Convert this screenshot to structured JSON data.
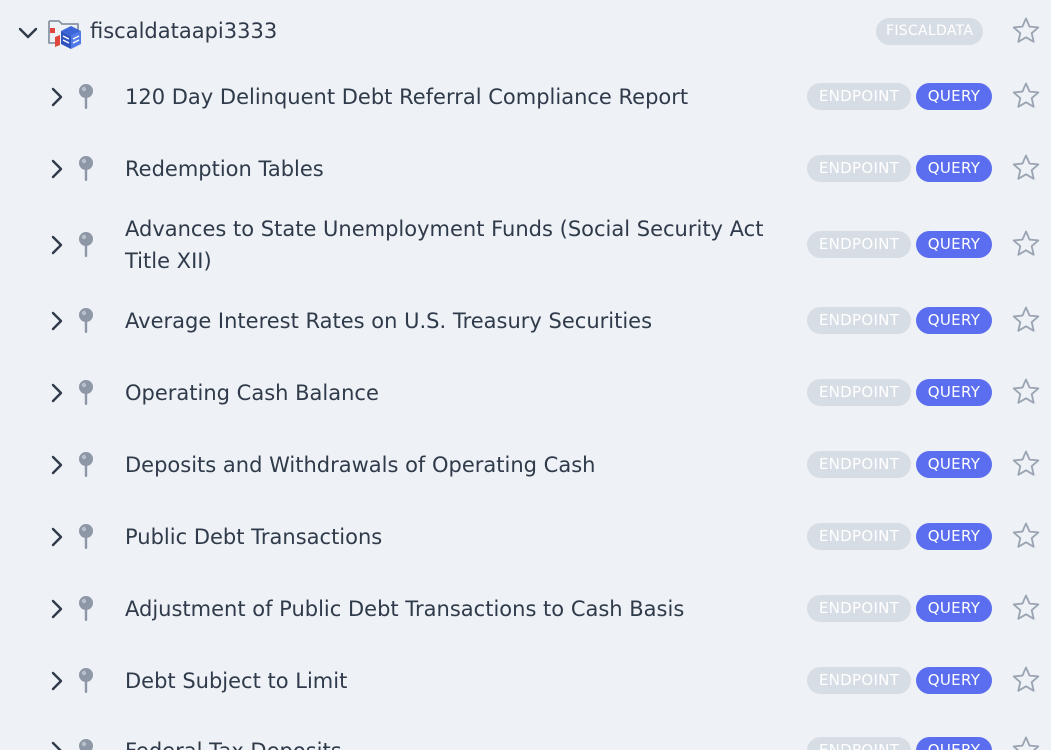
{
  "root": {
    "title": "fiscaldataapi3333",
    "badge": "FISCALDATA",
    "expanded": true
  },
  "badge_labels": {
    "endpoint": "ENDPOINT",
    "query": "QUERY"
  },
  "items": [
    {
      "label": "120 Day Delinquent Debt Referral Compliance Report"
    },
    {
      "label": "Redemption Tables"
    },
    {
      "label": "Advances to State Unemployment Funds (Social Security Act Title XII)"
    },
    {
      "label": "Average Interest Rates on U.S. Treasury Securities"
    },
    {
      "label": "Operating Cash Balance"
    },
    {
      "label": "Deposits and Withdrawals of Operating Cash"
    },
    {
      "label": "Public Debt Transactions"
    },
    {
      "label": "Adjustment of Public Debt Transactions to Cash Basis"
    },
    {
      "label": "Debt Subject to Limit"
    },
    {
      "label": "Federal Tax Deposits"
    }
  ],
  "colors": {
    "background": "#eef1f5",
    "endpoint_badge": "#d7dde5",
    "query_badge": "#5b6ef0",
    "star_outline": "#9aa4b2"
  },
  "icons": {
    "root_caret": "chevron-down-icon",
    "folder": "folder-icon",
    "row_caret": "chevron-right-icon",
    "pin": "pin-icon",
    "star": "star-outline-icon"
  }
}
